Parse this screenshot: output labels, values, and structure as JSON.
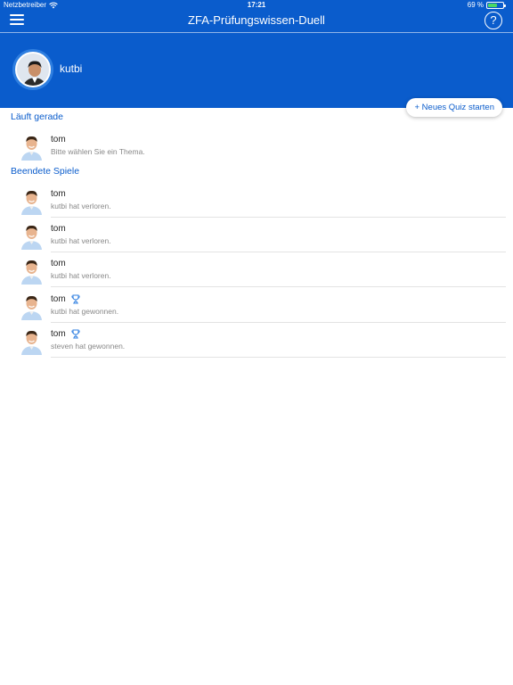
{
  "status_bar": {
    "carrier": "Netzbetreiber",
    "time": "17:21",
    "battery_percent": "69 %",
    "battery_level": 0.69,
    "battery_color": "#4cd964"
  },
  "nav": {
    "title": "ZFA-Prüfungswissen-Duell",
    "menu_icon": "hamburger-menu-icon",
    "help_label": "?"
  },
  "profile": {
    "username": "kutbi"
  },
  "actions": {
    "new_quiz": "+ Neues Quiz starten"
  },
  "sections": {
    "running": "Läuft gerade",
    "finished": "Beendete Spiele"
  },
  "running_games": [
    {
      "opponent": "tom",
      "status": "Bitte wählen Sie ein Thema."
    }
  ],
  "finished_games": [
    {
      "opponent": "tom",
      "status": "kutbi hat verloren.",
      "trophy": false
    },
    {
      "opponent": "tom",
      "status": "kutbi hat verloren.",
      "trophy": false
    },
    {
      "opponent": "tom",
      "status": "kutbi hat verloren.",
      "trophy": false
    },
    {
      "opponent": "tom",
      "status": "kutbi hat gewonnen.",
      "trophy": true
    },
    {
      "opponent": "tom",
      "status": "steven hat gewonnen.",
      "trophy": true
    }
  ],
  "colors": {
    "primary": "#0a5ccc",
    "header_bg": "#0a5ccc",
    "secondary_text": "#888888"
  }
}
